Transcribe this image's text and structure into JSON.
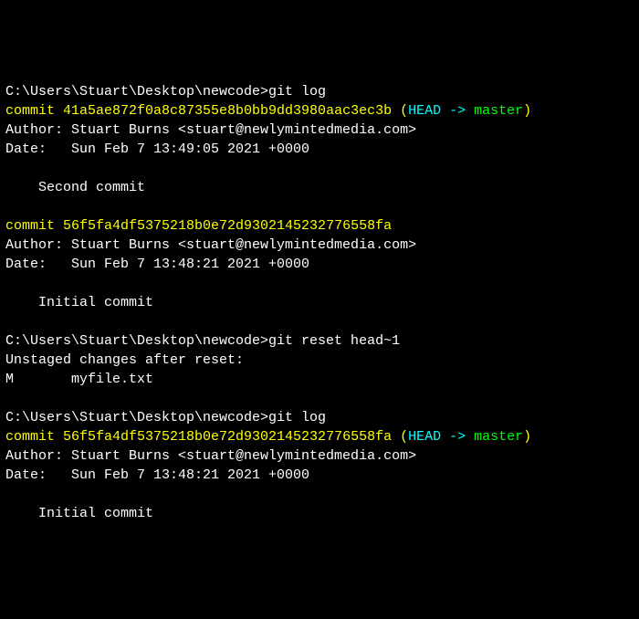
{
  "prompt1": {
    "path": "C:\\Users\\Stuart\\Desktop\\newcode>",
    "cmd": "git log"
  },
  "commit1": {
    "label": "commit ",
    "hash": "41a5ae872f0a8c87355e8b0bb9dd3980aac3ec3b",
    "ref_open": " (",
    "ref_head": "HEAD -> ",
    "ref_branch": "master",
    "ref_close": ")",
    "author": "Author: Stuart Burns <stuart@newlymintedmedia.com>",
    "date": "Date:   Sun Feb 7 13:49:05 2021 +0000",
    "msg": "    Second commit"
  },
  "commit2": {
    "label": "commit ",
    "hash": "56f5fa4df5375218b0e72d9302145232776558fa",
    "author": "Author: Stuart Burns <stuart@newlymintedmedia.com>",
    "date": "Date:   Sun Feb 7 13:48:21 2021 +0000",
    "msg": "    Initial commit"
  },
  "prompt2": {
    "path": "C:\\Users\\Stuart\\Desktop\\newcode>",
    "cmd": "git reset head~1"
  },
  "reset": {
    "line1": "Unstaged changes after reset:",
    "line2": "M       myfile.txt"
  },
  "prompt3": {
    "path": "C:\\Users\\Stuart\\Desktop\\newcode>",
    "cmd": "git log"
  },
  "commit3": {
    "label": "commit ",
    "hash": "56f5fa4df5375218b0e72d9302145232776558fa",
    "ref_open": " (",
    "ref_head": "HEAD -> ",
    "ref_branch": "master",
    "ref_close": ")",
    "author": "Author: Stuart Burns <stuart@newlymintedmedia.com>",
    "date": "Date:   Sun Feb 7 13:48:21 2021 +0000",
    "msg": "    Initial commit"
  }
}
